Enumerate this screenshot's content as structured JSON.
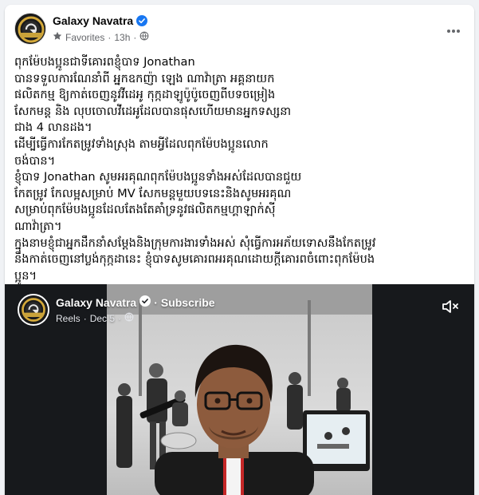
{
  "post": {
    "page_name": "Galaxy Navatra",
    "audience": "Favorites",
    "time": "13h",
    "text_lines": [
      "ពុកម៉ែបងប្អូនជាទីគោរពខ្ញុំបាទ Jonathan",
      "បានទទួលការណែនាំពី អ្នកឧកញ៉ា ឡេង ណាវ៉ាត្រា អគ្គនាយក",
      "ផលិតកម្ម ឱ្យកាត់ចេញនូវវីដេអូ កុក្កដាឡូប៉ូប៉ូចេញពីបទចម្រៀង",
      "សែកមន្ត និង លុបចោលវីដេអូដែលបានផុសហើយមានអ្នកទស្សនា",
      "ជាង 4 លានដង។",
      "ដើម្បីធ្វើការកែតម្រូវទាំងស្រុង តាមអ្វីដែលពុកម៉ែបងប្អូនលោក",
      "ចង់បាន។",
      "ខ្ញុំបាទ Jonathan សូមអរគុណពុកម៉ែបងប្អូនទាំងអស់ដែលបានជួយ",
      "កែតម្រូវ កែលម្អសម្រាប់ MV សែកមន្តមួយបទនេះនិងសូមអរគុណ",
      "សម្រាប់ពុកម៉ែបងប្អូនដែលតែងតែគាំទ្រនូវផលិតកម្មហ្គាឡាក់ស៊ី",
      "ណាវ៉ាត្រា។",
      "ក្នុងនាមខ្ញុំជាអ្នកដឹកនាំសម្តែងនិងក្រុមការងារទាំងអស់ សុំធ្វើការអភ័យទោសនឹងកែតម្រូវ",
      "នឹងកាត់ចេញនៅប្លង់កុក្កដានេះ ខ្ញុំបាទសូមគោរពអរគុណដោយក្តីគោរពចំពោះពុកម៉ែបង",
      "ប្អូន។"
    ]
  },
  "video": {
    "page_name": "Galaxy Navatra",
    "subscribe_label": "Subscribe",
    "separator": "·",
    "type_label": "Reels",
    "date": "Dec 5"
  },
  "icons": {
    "verified": "verified-badge-icon",
    "favorites": "star-icon",
    "globe": "globe-icon",
    "more": "more-dots-icon",
    "mute": "speaker-muted-icon"
  },
  "colors": {
    "verified_blue": "#1877f2",
    "secondary_text": "#65676b",
    "card_bg": "#ffffff",
    "page_bg": "#f0f2f5"
  }
}
